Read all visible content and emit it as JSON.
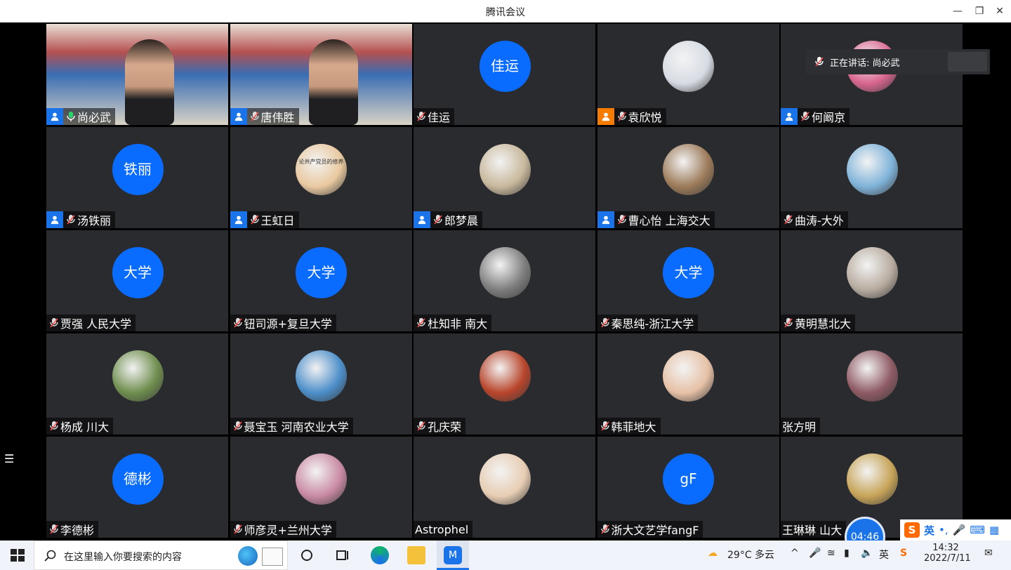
{
  "window": {
    "title": "腾讯会议"
  },
  "speaking": {
    "label": "正在讲话: 尚必武"
  },
  "timer": "04:46",
  "participants": [
    {
      "name": "尚必武",
      "kind": "video",
      "host": "blue",
      "mic": "on",
      "active": true
    },
    {
      "name": "唐伟胜",
      "kind": "video",
      "host": "blue",
      "mic": "off"
    },
    {
      "name": "佳运",
      "kind": "text",
      "avatar_text": "佳运",
      "mic": "off"
    },
    {
      "name": "袁欣悦",
      "kind": "photo",
      "photo_color": "#d7dce4",
      "host": "orange",
      "mic": "off"
    },
    {
      "name": "何阚京",
      "kind": "photo",
      "photo_color": "#d9668f",
      "host": "blue",
      "mic": "off"
    },
    {
      "name": "汤铁丽",
      "kind": "text",
      "avatar_text": "铁丽",
      "host": "blue",
      "mic": "off"
    },
    {
      "name": "王虹日",
      "kind": "photo",
      "photo_color": "#e9c9a0",
      "photo_text": "论共产党员的修养",
      "host": "blue",
      "mic": "off"
    },
    {
      "name": "郎梦晨",
      "kind": "photo",
      "photo_color": "#c8b89c",
      "host": "blue",
      "mic": "off"
    },
    {
      "name": "曹心怡 上海交大",
      "kind": "photo",
      "photo_color": "#9c7b5a",
      "host": "blue",
      "mic": "off"
    },
    {
      "name": "曲涛-大外",
      "kind": "photo",
      "photo_color": "#7fb3d9",
      "mic": "off"
    },
    {
      "name": "贾强  人民大学",
      "kind": "text",
      "avatar_text": "大学",
      "mic": "off"
    },
    {
      "name": "钮司源+复旦大学",
      "kind": "text",
      "avatar_text": "大学",
      "mic": "off"
    },
    {
      "name": "杜知非 南大",
      "kind": "photo",
      "photo_color": "#7d7d7d",
      "mic": "off"
    },
    {
      "name": "秦思纯-浙江大学",
      "kind": "text",
      "avatar_text": "大学",
      "mic": "off"
    },
    {
      "name": "黄明慧北大",
      "kind": "photo",
      "photo_color": "#b8aca0",
      "mic": "off"
    },
    {
      "name": "杨成  川大",
      "kind": "photo",
      "photo_color": "#6f8e4e",
      "mic": "off"
    },
    {
      "name": "聂宝玉 河南农业大学",
      "kind": "photo",
      "photo_color": "#4c8ec9",
      "mic": "off"
    },
    {
      "name": "孔庆荣",
      "kind": "photo",
      "photo_color": "#b8452b",
      "mic": "off"
    },
    {
      "name": "韩菲地大",
      "kind": "photo",
      "photo_color": "#e6c1a6",
      "mic": "off"
    },
    {
      "name": "张方明",
      "kind": "photo",
      "photo_color": "#8e5a63"
    },
    {
      "name": "李德彬",
      "kind": "text",
      "avatar_text": "德彬",
      "mic": "off"
    },
    {
      "name": "师彦灵+兰州大学",
      "kind": "photo",
      "photo_color": "#c98aa3",
      "mic": "off"
    },
    {
      "name": "Astrophel",
      "kind": "photo",
      "photo_color": "#e7cdb3"
    },
    {
      "name": "浙大文艺学fangF",
      "kind": "text",
      "avatar_text": "gF",
      "mic": "off"
    },
    {
      "name": "王琳琳 山大",
      "kind": "photo",
      "photo_color": "#c7a458"
    }
  ],
  "ime": {
    "lang": "英"
  },
  "taskbar": {
    "search_placeholder": "在这里输入你要搜索的内容",
    "weather": "29°C  多云",
    "ime_lang": "英",
    "time": "14:32",
    "date": "2022/7/11"
  },
  "colors": {
    "accent": "#0a6cff",
    "tile_bg": "#2a2b2f",
    "active_border": "#2bd36b"
  }
}
